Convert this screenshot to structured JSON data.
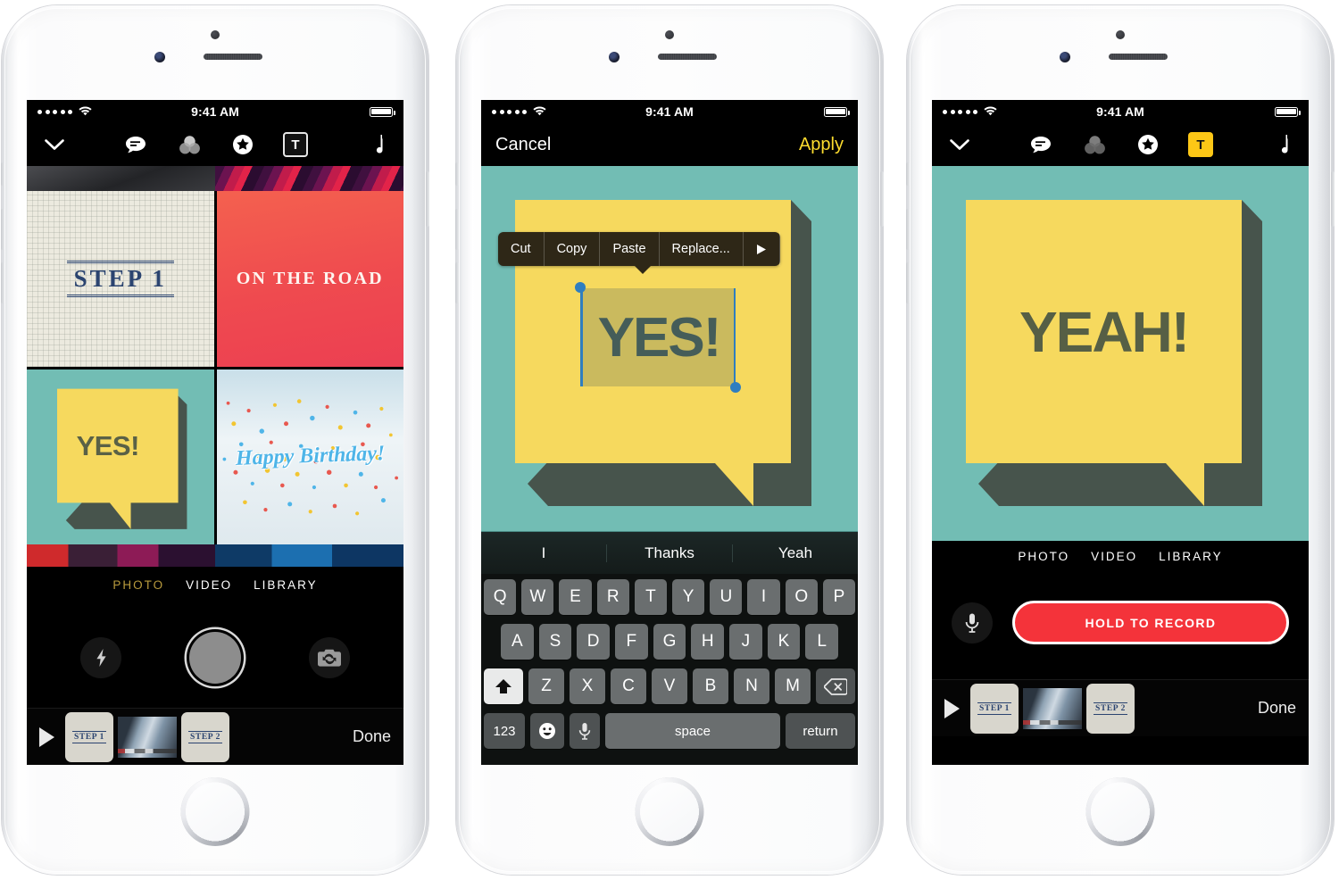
{
  "statusbar": {
    "time": "9:41 AM",
    "signal_dots": 5,
    "wifi": "wifi-icon",
    "battery": "battery-full-icon"
  },
  "phone1": {
    "toolbar": {
      "collapse": "chevron-down-icon",
      "items": [
        {
          "name": "comment-icon",
          "glyph": "speech"
        },
        {
          "name": "filters-icon",
          "glyph": "circles"
        },
        {
          "name": "sticker-star-icon",
          "glyph": "star"
        },
        {
          "name": "text-tool-icon",
          "glyph": "T",
          "state": "outlined"
        }
      ],
      "music": "music-note-icon"
    },
    "grid": [
      {
        "id": "tile-step1",
        "text": "STEP 1"
      },
      {
        "id": "tile-on-the-road",
        "text": "ON THE ROAD"
      },
      {
        "id": "tile-yes",
        "text": "YES!"
      },
      {
        "id": "tile-happy-birthday",
        "text": "Happy Birthday!"
      }
    ],
    "modes": [
      {
        "label": "PHOTO",
        "active": true
      },
      {
        "label": "VIDEO",
        "active": false
      },
      {
        "label": "LIBRARY",
        "active": false
      }
    ],
    "camera": {
      "flash": "flash-icon",
      "shutter": "shutter-button",
      "flip": "camera-flip-icon"
    },
    "filmstrip": {
      "play": "play-icon",
      "thumbs": [
        {
          "type": "paper",
          "label": "STEP 1"
        },
        {
          "type": "blur",
          "label": ""
        },
        {
          "type": "paper",
          "label": "STEP 2"
        }
      ],
      "done": "Done"
    }
  },
  "phone2": {
    "navbar": {
      "cancel": "Cancel",
      "apply": "Apply"
    },
    "callout": {
      "items": [
        "Cut",
        "Copy",
        "Paste",
        "Replace..."
      ],
      "more": "more-arrow-icon"
    },
    "canvas": {
      "bubble_text": "YES!",
      "bg_color": "#72bdb4",
      "bubble_color": "#f6d95e",
      "text_color": "#2a4a56"
    },
    "keyboard": {
      "suggestions": [
        "I",
        "Thanks",
        "Yeah"
      ],
      "row1": [
        "Q",
        "W",
        "E",
        "R",
        "T",
        "Y",
        "U",
        "I",
        "O",
        "P"
      ],
      "row2": [
        "A",
        "S",
        "D",
        "F",
        "G",
        "H",
        "J",
        "K",
        "L"
      ],
      "row3": [
        "Z",
        "X",
        "C",
        "V",
        "B",
        "N",
        "M"
      ],
      "shift": "shift-icon",
      "delete": "delete-icon",
      "numbers": "123",
      "emoji": "emoji-icon",
      "dictation": "microphone-icon",
      "space": "space",
      "return": "return"
    }
  },
  "phone3": {
    "toolbar": {
      "collapse": "chevron-down-icon",
      "items": [
        {
          "name": "comment-icon",
          "glyph": "speech"
        },
        {
          "name": "filters-icon",
          "glyph": "circles"
        },
        {
          "name": "sticker-star-icon",
          "glyph": "star"
        },
        {
          "name": "text-tool-icon",
          "glyph": "T",
          "state": "active"
        }
      ],
      "music": "music-note-icon"
    },
    "canvas": {
      "bubble_text": "YEAH!",
      "bg_color": "#72bdb4",
      "bubble_color": "#f6d95e",
      "text_color": "#565f45"
    },
    "modes": [
      {
        "label": "PHOTO",
        "active": false
      },
      {
        "label": "VIDEO",
        "active": false
      },
      {
        "label": "LIBRARY",
        "active": false
      }
    ],
    "record": {
      "mic": "microphone-icon",
      "label": "HOLD TO RECORD",
      "color": "#f4333a"
    },
    "filmstrip": {
      "play": "play-icon",
      "thumbs": [
        {
          "type": "paper",
          "label": "STEP 1"
        },
        {
          "type": "blur",
          "label": ""
        },
        {
          "type": "paper",
          "label": "STEP 2"
        }
      ],
      "done": "Done"
    }
  }
}
